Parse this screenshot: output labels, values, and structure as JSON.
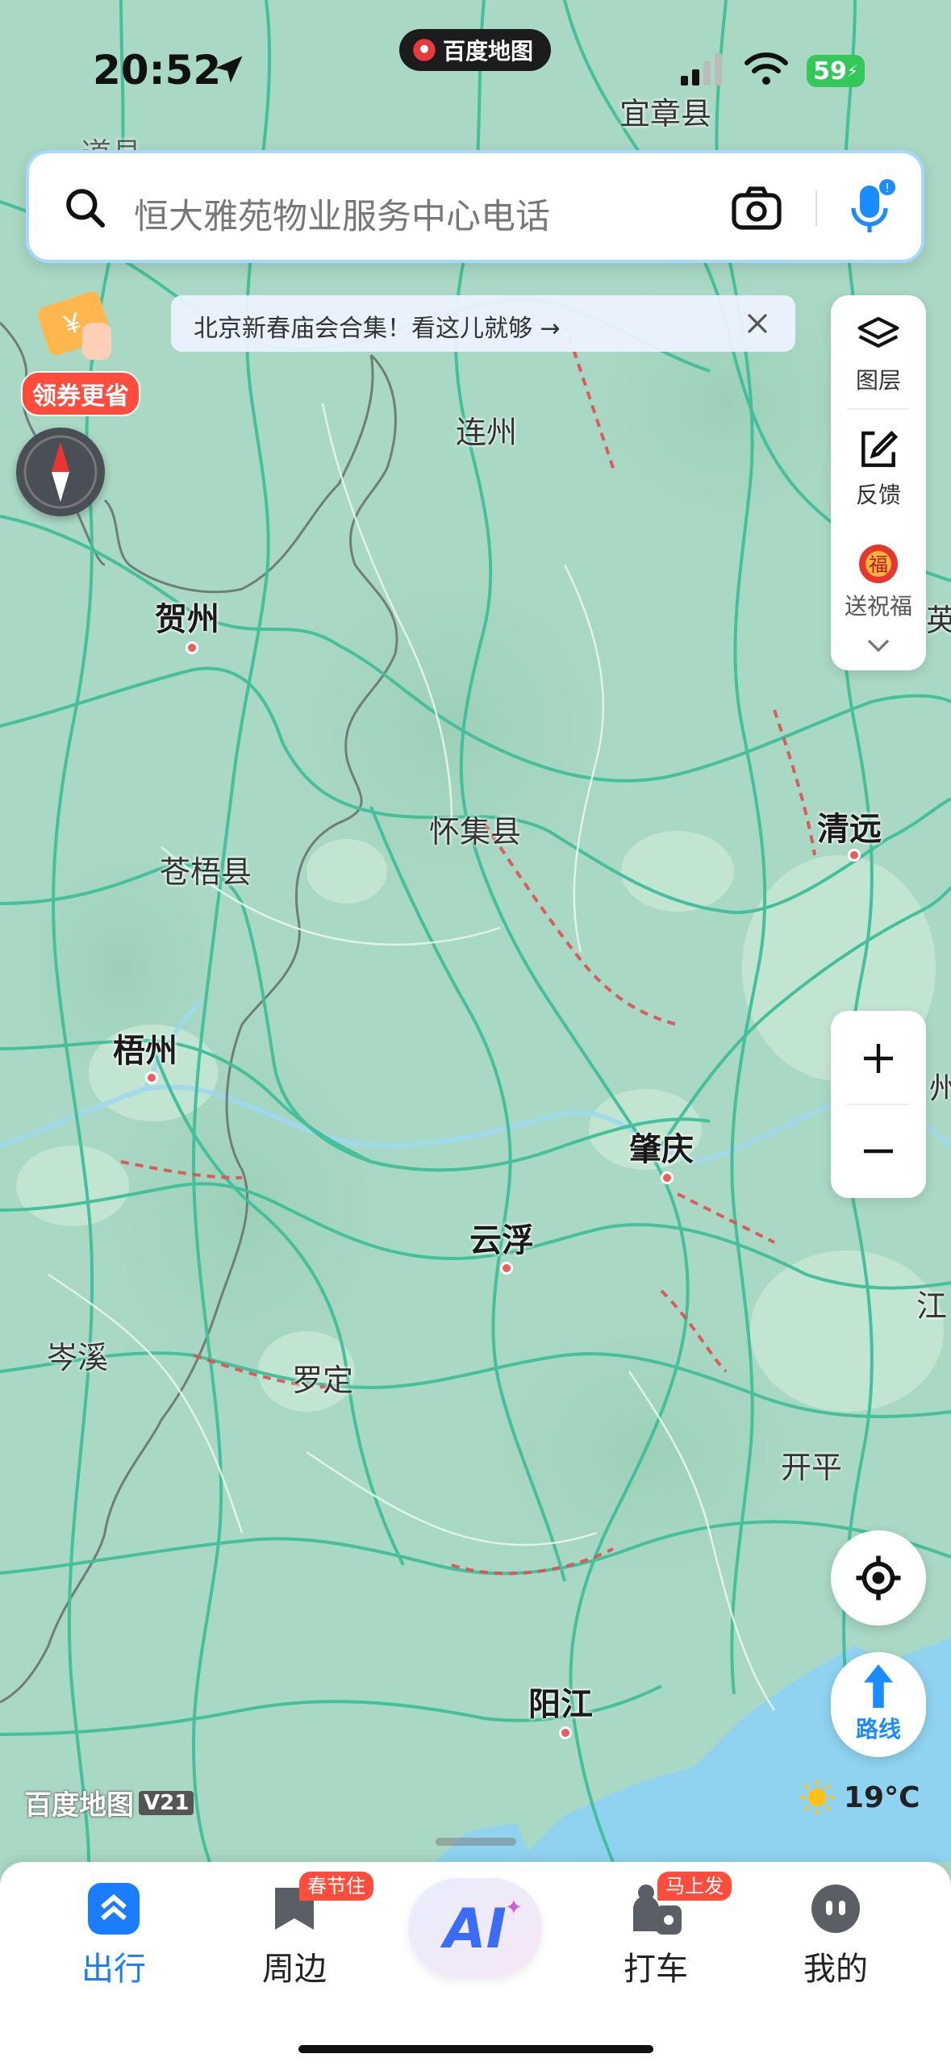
{
  "status_bar": {
    "time": "20:52",
    "app_pill": "百度地图",
    "battery": "59"
  },
  "search": {
    "placeholder": "恒大雅苑物业服务中心电话"
  },
  "banner": {
    "text": "北京新春庙会合集！看这儿就够 →"
  },
  "promo": {
    "label": "领券更省"
  },
  "side_panel": {
    "layers": "图层",
    "feedback": "反馈",
    "blessing": "送祝福"
  },
  "map": {
    "cities": [
      "宜章县",
      "连州",
      "贺州",
      "怀集县",
      "清远",
      "苍梧县",
      "梧州",
      "肇庆",
      "云浮",
      "岑溪",
      "罗定",
      "开平",
      "阳江"
    ],
    "edge_labels": [
      "道县",
      "英",
      "州",
      "江"
    ],
    "colors": {
      "land": "#a9d8c4",
      "road": "#3fbf9a",
      "congestion": "#e05050",
      "sea": "#8fd3f0"
    }
  },
  "watermark": {
    "logo": "百度地图",
    "version": "V21"
  },
  "weather": {
    "temp": "19°C"
  },
  "route_button": {
    "label": "路线"
  },
  "tabs": [
    {
      "label": "出行",
      "icon": "chevron-up-icon",
      "active": true
    },
    {
      "label": "周边",
      "icon": "bookmark-icon",
      "badge": "春节住"
    },
    {
      "label": "AI",
      "icon": "ai-icon"
    },
    {
      "label": "打车",
      "icon": "taxi-icon",
      "badge": "马上发"
    },
    {
      "label": "我的",
      "icon": "profile-icon"
    }
  ]
}
